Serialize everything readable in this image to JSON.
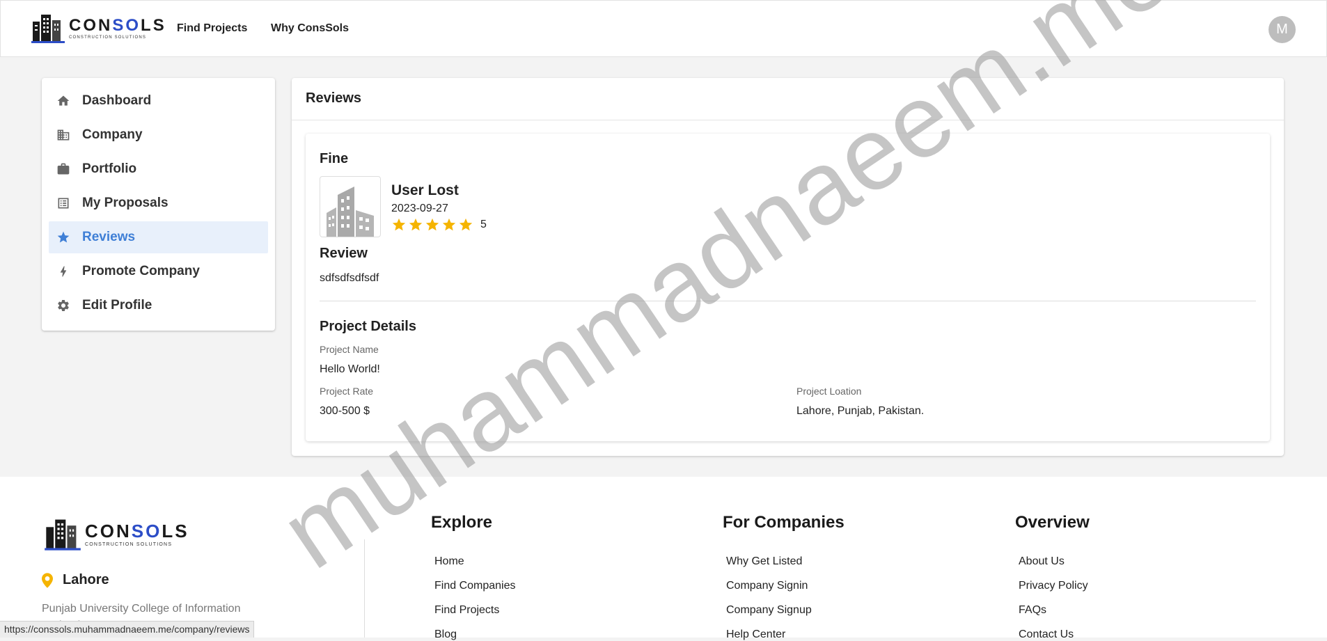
{
  "header": {
    "logo": {
      "name_pre": "CON",
      "name_hl": "SO",
      "name_post": "LS",
      "tagline": "CONSTRUCTION SOLUTIONS"
    },
    "nav": [
      {
        "label": "Find Projects"
      },
      {
        "label": "Why ConsSols"
      }
    ],
    "avatar_initial": "M"
  },
  "sidebar": {
    "items": [
      {
        "label": "Dashboard",
        "icon": "home-icon",
        "active": false
      },
      {
        "label": "Company",
        "icon": "building-icon",
        "active": false
      },
      {
        "label": "Portfolio",
        "icon": "briefcase-icon",
        "active": false
      },
      {
        "label": "My Proposals",
        "icon": "list-icon",
        "active": false
      },
      {
        "label": "Reviews",
        "icon": "star-icon",
        "active": true
      },
      {
        "label": "Promote Company",
        "icon": "bolt-icon",
        "active": false
      },
      {
        "label": "Edit Profile",
        "icon": "gear-icon",
        "active": false
      }
    ]
  },
  "main": {
    "title": "Reviews",
    "review": {
      "title": "Fine",
      "reviewer": "User Lost",
      "date": "2023-09-27",
      "rating": 5,
      "rating_text": "5",
      "review_heading": "Review",
      "review_text": "sdfsdfsdfsdf",
      "project_heading": "Project Details",
      "project_name_label": "Project Name",
      "project_name": "Hello World!",
      "project_rate_label": "Project Rate",
      "project_rate": "300-500 $",
      "project_location_label": "Project Loation",
      "project_location": "Lahore, Punjab, Pakistan."
    }
  },
  "footer": {
    "city": "Lahore",
    "address": "Punjab University College of Information Technology",
    "explore": {
      "title": "Explore",
      "links": [
        "Home",
        "Find Companies",
        "Find Projects",
        "Blog"
      ]
    },
    "companies": {
      "title": "For Companies",
      "links": [
        "Why Get Listed",
        "Company Signin",
        "Company Signup",
        "Help Center"
      ]
    },
    "overview": {
      "title": "Overview",
      "links": [
        "About Us",
        "Privacy Policy",
        "FAQs",
        "Contact Us"
      ]
    }
  },
  "watermark": "muhammadnaeem.me",
  "status_url": "https://conssols.muhammadnaeem.me/company/reviews",
  "colors": {
    "accent": "#3f7fd6",
    "active_bg": "#e8f0fb",
    "star": "#f5b400",
    "logo_blue": "#2c4dc7"
  }
}
